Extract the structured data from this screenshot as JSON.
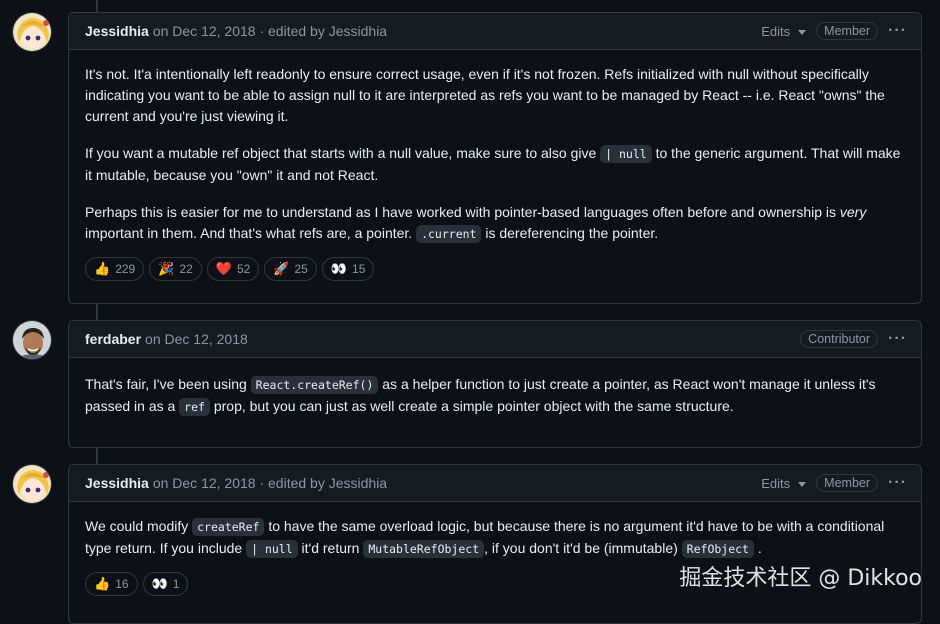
{
  "comments": [
    {
      "author": "Jessidhia",
      "meta": "on Dec 12, 2018 · edited by Jessidhia",
      "edits_label": "Edits",
      "role": "Member",
      "paragraphs": [
        {
          "t1": "It's not. It'a intentionally left readonly to ensure correct usage, even if it's not frozen. Refs initialized with null without specifically indicating you want to be able to assign null to it are interpreted as refs you want to be managed by React -- i.e. React \"owns\" the current and you're just viewing it."
        },
        {
          "t1": "If you want a mutable ref object that starts with a null value, make sure to also give ",
          "code1": "| null",
          "t2": " to the generic argument. That will make it mutable, because you \"own\" it and not React."
        },
        {
          "t1": "Perhaps this is easier for me to understand as I have worked with pointer-based languages often before and ownership is ",
          "em": "very",
          "t2": " important in them. And that's what refs are, a pointer. ",
          "code1": ".current",
          "t3": " is dereferencing the pointer."
        }
      ],
      "reactions": [
        {
          "emoji": "👍",
          "count": "229"
        },
        {
          "emoji": "🎉",
          "count": "22"
        },
        {
          "emoji": "❤️",
          "count": "52"
        },
        {
          "emoji": "🚀",
          "count": "25"
        },
        {
          "emoji": "👀",
          "count": "15"
        }
      ]
    },
    {
      "author": "ferdaber",
      "meta": "on Dec 12, 2018",
      "role": "Contributor",
      "paragraphs": [
        {
          "t1": "That's fair, I've been using ",
          "code1": "React.createRef()",
          "t2": " as a helper function to just create a pointer, as React won't manage it unless it's passed in as a ",
          "code2": "ref",
          "t3": " prop, but you can just as well create a simple pointer object with the same structure."
        }
      ]
    },
    {
      "author": "Jessidhia",
      "meta": "on Dec 12, 2018 · edited by Jessidhia",
      "edits_label": "Edits",
      "role": "Member",
      "paragraphs": [
        {
          "t1": "We could modify ",
          "code1": "createRef",
          "t2": " to have the same overload logic, but because there is no argument it'd have to be with a conditional type return. If you include ",
          "code2": "| null",
          "t3": " it'd return ",
          "code3": "MutableRefObject",
          "t4": ", if you don't it'd be (immutable) ",
          "code4": "RefObject",
          "t5": " ."
        }
      ],
      "reactions": [
        {
          "emoji": "👍",
          "count": "16"
        },
        {
          "emoji": "👀",
          "count": "1"
        }
      ]
    }
  ],
  "watermark": "掘金技术社区 @ Dikkoo"
}
